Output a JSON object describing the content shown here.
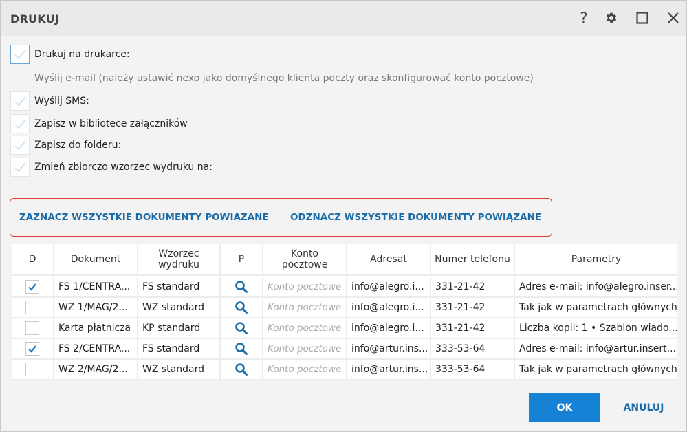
{
  "window": {
    "title": "DRUKUJ",
    "help_label": "?"
  },
  "options": [
    {
      "label": "Drukuj na drukarce:",
      "checked": false,
      "disabled": false
    },
    {
      "label": "Wyślij e-mail (należy ustawić nexo jako domyślnego klienta poczty oraz skonfigurować konto pocztowe)",
      "checked": false,
      "disabled": true
    },
    {
      "label": "Wyślij SMS:",
      "checked": false,
      "disabled": false
    },
    {
      "label": "Zapisz w bibliotece załączników",
      "checked": false,
      "disabled": false
    },
    {
      "label": "Zapisz do folderu:",
      "checked": false,
      "disabled": false
    },
    {
      "label": "Zmień zbiorczo wzorzec wydruku na:",
      "checked": false,
      "disabled": false
    }
  ],
  "links": {
    "select_all": "ZAZNACZ WSZYSTKIE DOKUMENTY POWIĄZANE",
    "deselect_all": "ODZNACZ WSZYSTKIE DOKUMENTY POWIĄZANE"
  },
  "grid": {
    "columns": [
      "D",
      "Dokument",
      "Wzorzec wydruku",
      "P",
      "Konto pocztowe",
      "Adresat",
      "Numer telefonu",
      "Parametry"
    ],
    "rows": [
      {
        "checked": true,
        "dokument": "FS 1/CENTRA...",
        "wzorzec": "FS standard",
        "konto": "Konto pocztowe",
        "adresat": "info@alegro.i...",
        "telefon": "331-21-42",
        "parametry": "Adres e-mail: info@alegro.inser..."
      },
      {
        "checked": false,
        "dokument": "WZ 1/MAG/2...",
        "wzorzec": "WZ standard",
        "konto": "Konto pocztowe",
        "adresat": "info@alegro.i...",
        "telefon": "331-21-42",
        "parametry": "Tak jak w parametrach głównych"
      },
      {
        "checked": false,
        "dokument": "Karta płatnicza",
        "wzorzec": "KP standard",
        "konto": "Konto pocztowe",
        "adresat": "info@alegro.i...",
        "telefon": "331-21-42",
        "parametry": "Liczba kopii: 1 • Szablon wiado..."
      },
      {
        "checked": true,
        "dokument": "FS 2/CENTRA...",
        "wzorzec": "FS standard",
        "konto": "Konto pocztowe",
        "adresat": "info@artur.ins...",
        "telefon": "333-53-64",
        "parametry": "Adres e-mail: info@artur.insert...."
      },
      {
        "checked": false,
        "dokument": "WZ 2/MAG/2...",
        "wzorzec": "WZ standard",
        "konto": "Konto pocztowe",
        "adresat": "info@artur.ins...",
        "telefon": "333-53-64",
        "parametry": "Tak jak w parametrach głównych"
      }
    ]
  },
  "buttons": {
    "ok": "OK",
    "cancel": "ANULUJ"
  },
  "colors": {
    "accent": "#1582d6",
    "link": "#1a6ca8",
    "highlight_border": "#e03a3a",
    "check": "#1a7cc4"
  }
}
